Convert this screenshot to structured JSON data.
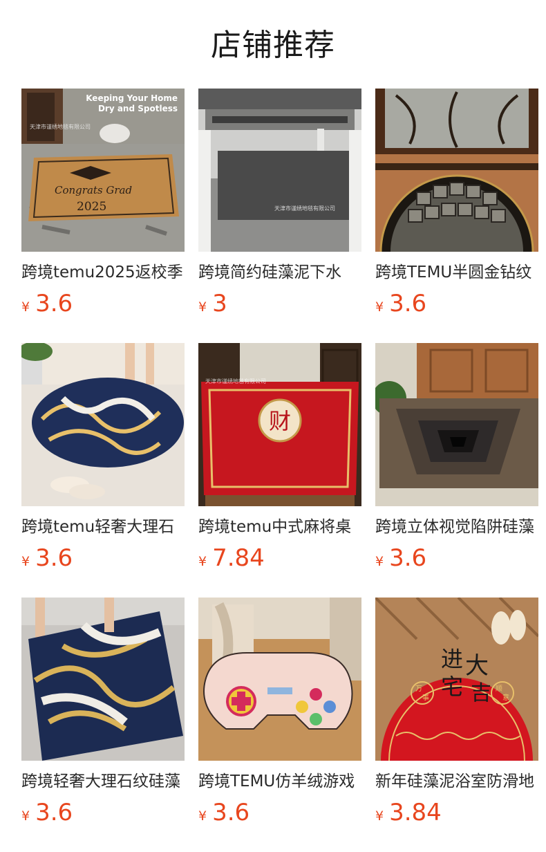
{
  "page_title": "店铺推荐",
  "currency_symbol": "¥",
  "products": [
    {
      "name": "跨境temu2025返校季",
      "price": "3.6",
      "image": "graduation-doormat",
      "overlay_text": [
        "Keeping Your Home",
        "Dry and Spotless"
      ],
      "watermark": "天津市谨绣地毯有限公司",
      "mat_text": "Congrats Grad",
      "mat_year": "2025"
    },
    {
      "name": "跨境简约硅藻泥下水",
      "price": "3",
      "image": "under-sink-mat",
      "watermark": "天津市谨绣地毯有限公司"
    },
    {
      "name": "跨境TEMU半圆金钻纹",
      "price": "3.6",
      "image": "half-round-stone-mat"
    },
    {
      "name": "跨境temu轻奢大理石",
      "price": "3.6",
      "image": "oval-marble-bath-mat"
    },
    {
      "name": "跨境temu中式麻将桌",
      "price": "7.84",
      "image": "mahjong-table-mat",
      "watermark": "天津市谨绣地毯有限公司",
      "mat_text": "财"
    },
    {
      "name": "跨境立体视觉陷阱硅藻",
      "price": "3.6",
      "image": "3d-illusion-doormat"
    },
    {
      "name": "跨境轻奢大理石纹硅藻",
      "price": "3.6",
      "image": "marble-bath-mat"
    },
    {
      "name": "跨境TEMU仿羊绒游戏",
      "price": "3.6",
      "image": "gamepad-rug"
    },
    {
      "name": "新年硅藻泥浴室防滑地",
      "price": "3.84",
      "image": "new-year-doormat",
      "mat_text": [
        "进",
        "宅",
        "大",
        "吉",
        "万",
        "事",
        "顺",
        "意"
      ]
    }
  ],
  "colors": {
    "price": "#e8461e",
    "title": "#1a1a1a"
  }
}
